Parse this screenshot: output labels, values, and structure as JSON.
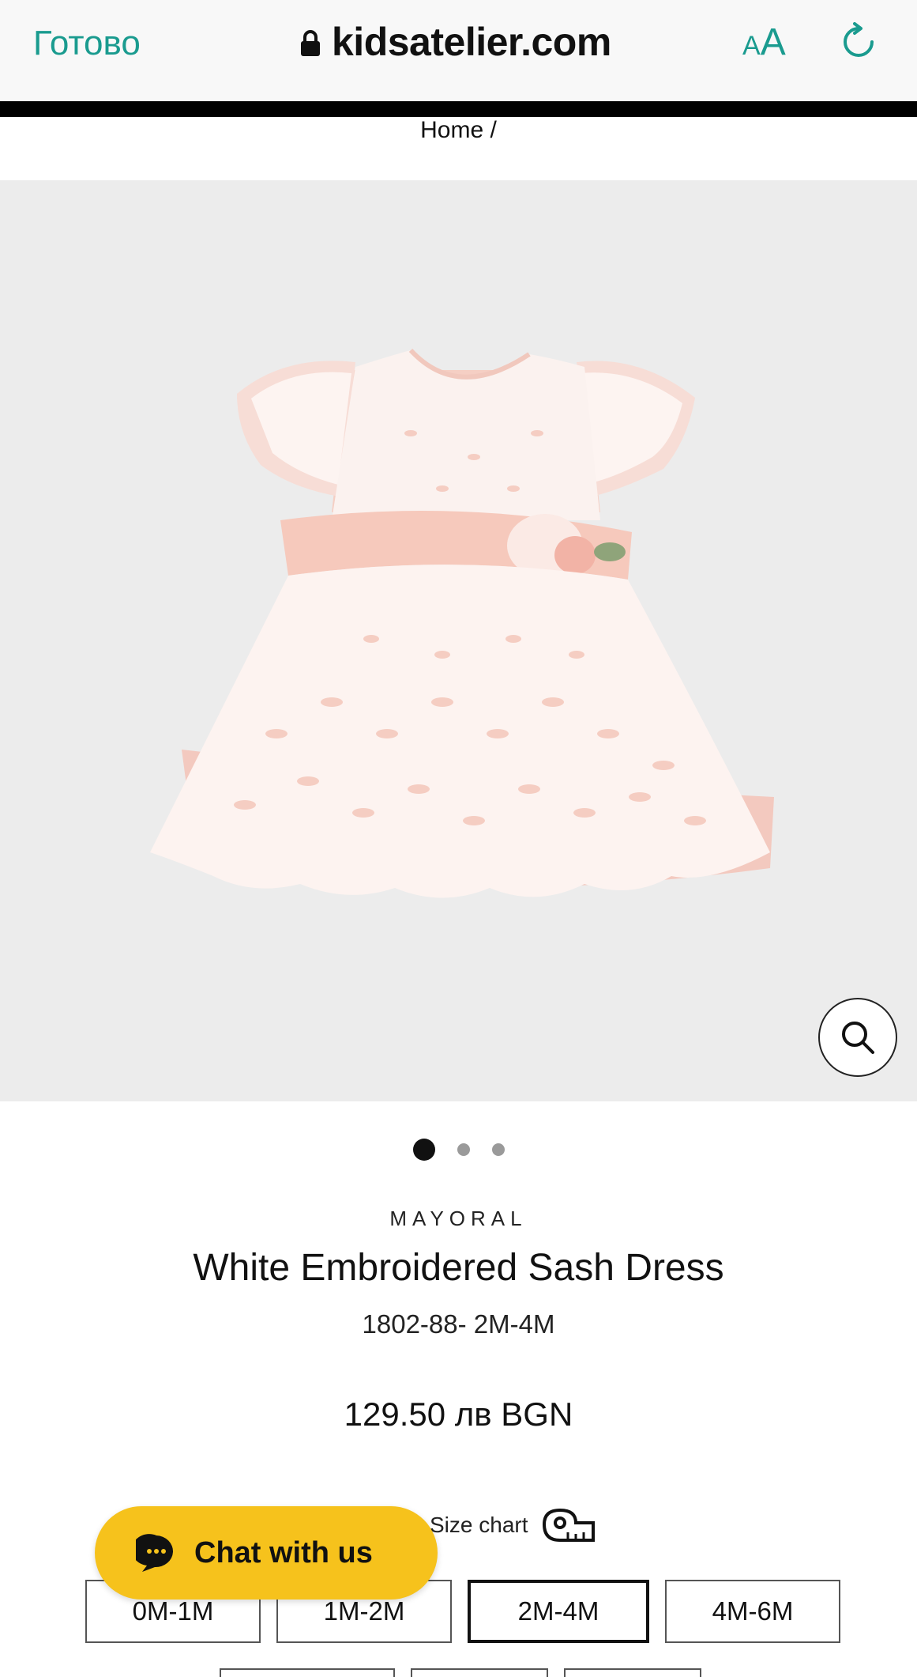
{
  "browser": {
    "done_label": "Готово",
    "url": "kidsatelier.com",
    "text_size_small": "A",
    "text_size_big": "A"
  },
  "breadcrumb": {
    "text": "Home /"
  },
  "product": {
    "brand": "MAYORAL",
    "title": "White Embroidered Sash Dress",
    "sku": "1802-88- 2M-4M",
    "price": "129.50 лв BGN",
    "image_dots": {
      "count": 3,
      "active_index": 0
    }
  },
  "size_chart": {
    "label": "Size chart",
    "icon": "ruler-icon"
  },
  "sizes": {
    "options": [
      "0M-1M",
      "1M-2M",
      "2M-4M",
      "4M-6M"
    ],
    "selected": "2M-4M"
  },
  "chat": {
    "label": "Chat with us",
    "icon": "chat-bubble-icon",
    "color": "#f6c21c"
  },
  "colors": {
    "accent": "#1a9b8f",
    "background_image": "#ececec"
  }
}
